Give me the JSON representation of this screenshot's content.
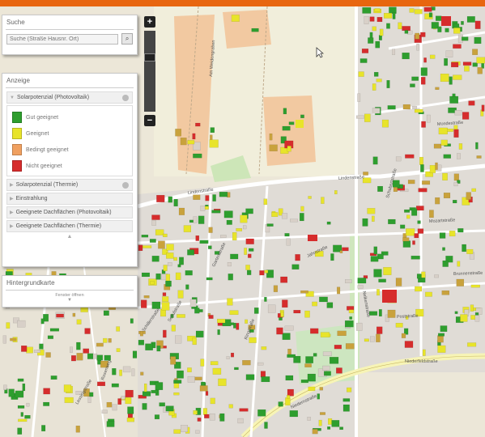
{
  "search": {
    "title": "Suche",
    "placeholder": "Suche (Straße Hausnr. Ort)"
  },
  "display": {
    "title": "Anzeige",
    "active_layer": "Solarpotenzial (Photovoltaik)",
    "legend": [
      {
        "label": "Gut geeignet",
        "color": "#2e9e2e"
      },
      {
        "label": "Geeignet",
        "color": "#e8e42a"
      },
      {
        "label": "Bedingt geeignet",
        "color": "#f0a060"
      },
      {
        "label": "Nicht geeignet",
        "color": "#d62c2c"
      }
    ],
    "layers": [
      {
        "label": "Solarpotenzial (Thermie)"
      },
      {
        "label": "Einstrahlung"
      },
      {
        "label": "Geeignete Dachflächen (Photovoltaik)"
      },
      {
        "label": "Geeignete Dachflächen (Thermie)"
      }
    ]
  },
  "basemap": {
    "title": "Hintergrundkarte",
    "toggle_label": "Fenster öffnen"
  },
  "zoom": {
    "in_label": "+",
    "out_label": "−"
  },
  "streets": [
    "Am Weidengraben",
    "Lindenstraße",
    "Lindenstraße",
    "Mondestraße",
    "Schubertstraße",
    "Mozartstraße",
    "Jahnstraße",
    "Schulstraße",
    "Gartenstraße",
    "Schillerstraße",
    "Ringstraße",
    "Poststraße",
    "Nelkenstraße",
    "Niederfeldstraße",
    "Niedernstraße",
    "Rosenweg",
    "Lessingstraße",
    "Brunnenstraße"
  ]
}
